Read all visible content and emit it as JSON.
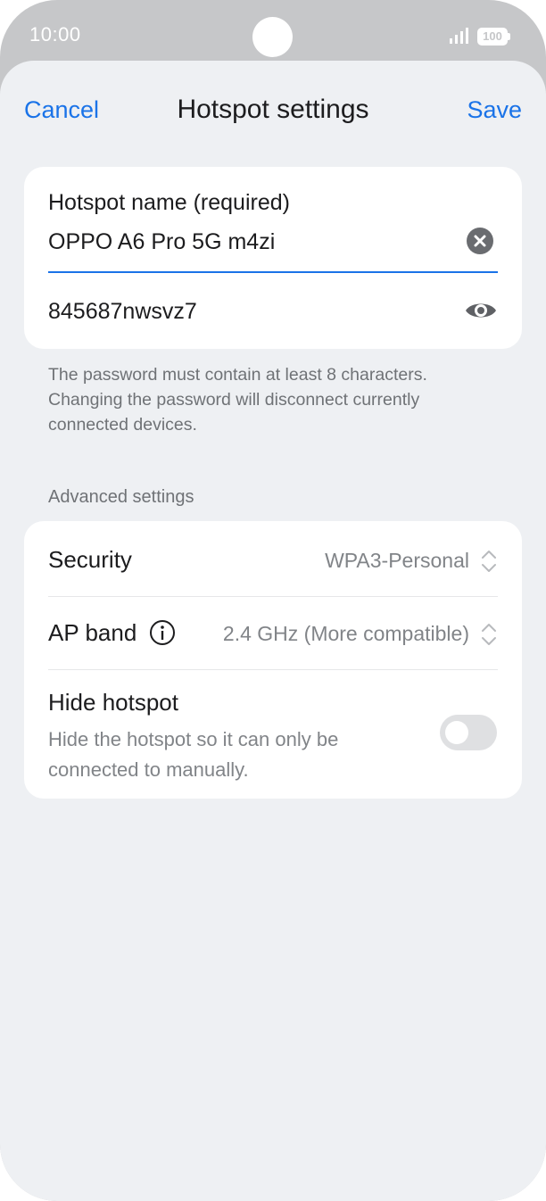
{
  "status_bar": {
    "time": "10:00",
    "battery": "100"
  },
  "header": {
    "cancel_label": "Cancel",
    "title": "Hotspot settings",
    "save_label": "Save"
  },
  "hotspot_card": {
    "name_label": "Hotspot name (required)",
    "name_value": "OPPO A6 Pro 5G m4zi",
    "password_value": "845687nwsvz7"
  },
  "hint_text": "The password must contain at least 8 characters. Changing the password will disconnect currently connected devices.",
  "advanced": {
    "section_label": "Advanced settings",
    "security_label": "Security",
    "security_value": "WPA3-Personal",
    "ap_band_label": "AP band",
    "ap_band_value": "2.4 GHz (More compatible)",
    "hide_label": "Hide hotspot",
    "hide_description": "Hide the hotspot so it can only be connected to manually.",
    "hide_enabled": false
  },
  "colors": {
    "accent": "#1a73e8",
    "background": "#eef0f3",
    "card": "#ffffff"
  },
  "icons": [
    "signal-icon",
    "battery-icon",
    "clear-icon",
    "eye-icon",
    "info-icon",
    "updown-icon"
  ]
}
